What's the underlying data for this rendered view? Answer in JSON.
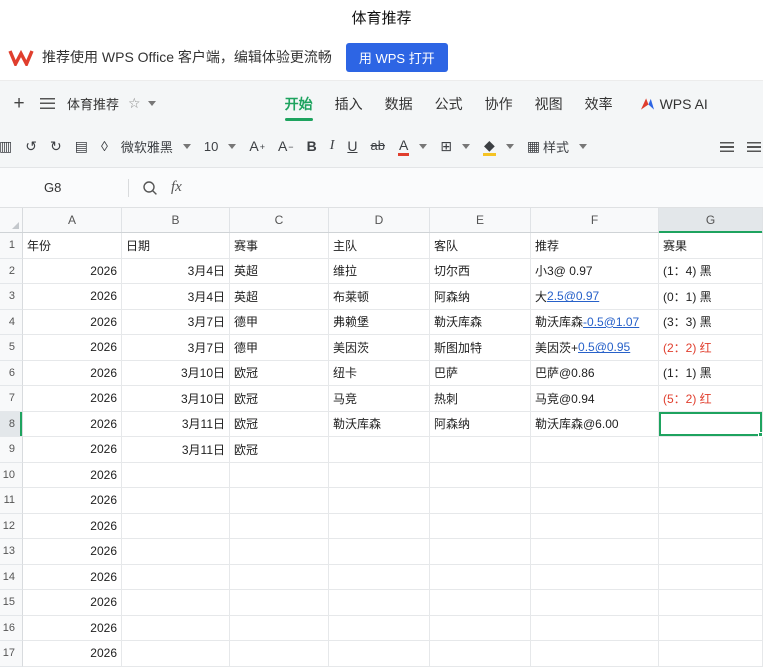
{
  "accent": {
    "green": "#1ea35f",
    "blue_button": "#2d65e4",
    "link": "#2761c9",
    "red": "#e03e2d"
  },
  "titlebar": {
    "title": "体育推荐"
  },
  "banner": {
    "logo": "wps-logo",
    "text": "推荐使用 WPS Office 客户端，编辑体验更流畅",
    "button_label": "用 WPS 打开"
  },
  "menubar": {
    "plus": "+",
    "doc_name": "体育推荐",
    "star": "☆",
    "tabs": [
      "开始",
      "插入",
      "数据",
      "公式",
      "协作",
      "视图",
      "效率"
    ],
    "active_tab": "开始",
    "ai_label": "WPS AI"
  },
  "toolbar": {
    "items": [
      {
        "name": "clipboard-icon",
        "glyph": "▥",
        "cut": true
      },
      {
        "name": "undo-icon",
        "glyph": "↺"
      },
      {
        "name": "redo-icon",
        "glyph": "↻"
      },
      {
        "name": "format-painter-icon",
        "glyph": "▤"
      },
      {
        "name": "eraser-icon",
        "glyph": "◊"
      },
      {
        "name": "font-name-select",
        "label": "微软雅黑",
        "caret": true
      },
      {
        "name": "font-size-select",
        "label": "10",
        "caret": true
      },
      {
        "name": "font-increase-button",
        "glyph": "A",
        "sup": "+"
      },
      {
        "name": "font-decrease-button",
        "glyph": "A",
        "sup": "−"
      },
      {
        "name": "bold-button",
        "glyph": "B",
        "cls": "b"
      },
      {
        "name": "italic-button",
        "glyph": "I",
        "cls": "i"
      },
      {
        "name": "underline-button",
        "glyph": "U",
        "cls": "u"
      },
      {
        "name": "strikethrough-button",
        "glyph": "ab",
        "cls": "s"
      },
      {
        "name": "font-color-button",
        "glyph": "A",
        "bar": "#e03e2d",
        "caret": true
      },
      {
        "name": "borders-button",
        "glyph": "⊞",
        "caret": true
      },
      {
        "name": "fill-color-button",
        "glyph": "◆",
        "bar": "#f5c324",
        "caret": true
      },
      {
        "name": "cell-style-button",
        "glyph": "▦",
        "label": "样式",
        "caret": true
      },
      {
        "name": "align-button",
        "lines": true,
        "push": true
      },
      {
        "name": "align-more-button",
        "lines": true,
        "clipr": true
      }
    ]
  },
  "formula_bar": {
    "cell_ref": "G8",
    "fx_label": "fx"
  },
  "sheet": {
    "columns": [
      "A",
      "B",
      "C",
      "D",
      "E",
      "F",
      "G"
    ],
    "more_label": "⋯",
    "selected_cell": "G8",
    "selected_col": "G",
    "selected_row": 8,
    "rows": [
      {
        "n": 1,
        "cells": [
          {
            "t": "年份"
          },
          {
            "t": "日期"
          },
          {
            "t": "赛事"
          },
          {
            "t": "主队"
          },
          {
            "t": "客队"
          },
          {
            "t": "推荐"
          },
          {
            "t": "赛果"
          }
        ]
      },
      {
        "n": 2,
        "cells": [
          {
            "t": "2026",
            "align": "r"
          },
          {
            "t": "3月4日",
            "align": "r"
          },
          {
            "t": "英超"
          },
          {
            "t": "维拉"
          },
          {
            "t": "切尔西"
          },
          {
            "t": "小3@ 0.97"
          },
          {
            "t": "(1：4) 黑"
          }
        ]
      },
      {
        "n": 3,
        "cells": [
          {
            "t": "2026",
            "align": "r"
          },
          {
            "t": "3月4日",
            "align": "r"
          },
          {
            "t": "英超"
          },
          {
            "t": "布莱顿"
          },
          {
            "t": "阿森纳"
          },
          {
            "parts": [
              {
                "t": "大"
              },
              {
                "t": "2.5@0.97",
                "link": true
              }
            ]
          },
          {
            "t": "(0：1) 黑"
          }
        ]
      },
      {
        "n": 4,
        "cells": [
          {
            "t": "2026",
            "align": "r"
          },
          {
            "t": "3月7日",
            "align": "r"
          },
          {
            "t": "德甲"
          },
          {
            "t": "弗赖堡"
          },
          {
            "t": "勒沃库森"
          },
          {
            "parts": [
              {
                "t": "勒沃库森"
              },
              {
                "t": "-0.5@1.07",
                "link": true
              }
            ]
          },
          {
            "t": "(3：3) 黑"
          }
        ]
      },
      {
        "n": 5,
        "cells": [
          {
            "t": "2026",
            "align": "r"
          },
          {
            "t": "3月7日",
            "align": "r"
          },
          {
            "t": "德甲"
          },
          {
            "t": "美因茨"
          },
          {
            "t": "斯图加特"
          },
          {
            "parts": [
              {
                "t": "美因茨+"
              },
              {
                "t": "0.5@0.95",
                "link": true
              }
            ]
          },
          {
            "t": "(2：2) 红",
            "red": true
          }
        ]
      },
      {
        "n": 6,
        "cells": [
          {
            "t": "2026",
            "align": "r"
          },
          {
            "t": "3月10日",
            "align": "r"
          },
          {
            "t": "欧冠"
          },
          {
            "t": "纽卡"
          },
          {
            "t": "巴萨"
          },
          {
            "t": "巴萨@0.86"
          },
          {
            "t": "(1：1) 黑"
          }
        ]
      },
      {
        "n": 7,
        "cells": [
          {
            "t": "2026",
            "align": "r"
          },
          {
            "t": "3月10日",
            "align": "r"
          },
          {
            "t": "欧冠"
          },
          {
            "t": "马竞"
          },
          {
            "t": "热刺"
          },
          {
            "t": "马竞@0.94"
          },
          {
            "t": "(5：2) 红",
            "red": true
          }
        ]
      },
      {
        "n": 8,
        "cells": [
          {
            "t": "2026",
            "align": "r"
          },
          {
            "t": "3月11日",
            "align": "r"
          },
          {
            "t": "欧冠"
          },
          {
            "t": "勒沃库森"
          },
          {
            "t": "阿森纳"
          },
          {
            "t": "勒沃库森@6.00"
          },
          {
            "t": "",
            "selected": true
          }
        ]
      },
      {
        "n": 9,
        "cells": [
          {
            "t": "2026",
            "align": "r"
          },
          {
            "t": "3月11日",
            "align": "r"
          },
          {
            "t": "欧冠"
          },
          {
            "t": ""
          },
          {
            "t": ""
          },
          {
            "t": ""
          },
          {
            "t": ""
          }
        ]
      },
      {
        "n": 10,
        "cells": [
          {
            "t": "2026",
            "align": "r"
          },
          {
            "t": ""
          },
          {
            "t": ""
          },
          {
            "t": ""
          },
          {
            "t": ""
          },
          {
            "t": ""
          },
          {
            "t": ""
          }
        ]
      },
      {
        "n": 11,
        "cells": [
          {
            "t": "2026",
            "align": "r"
          },
          {
            "t": ""
          },
          {
            "t": ""
          },
          {
            "t": ""
          },
          {
            "t": ""
          },
          {
            "t": ""
          },
          {
            "t": ""
          }
        ]
      },
      {
        "n": 12,
        "cells": [
          {
            "t": "2026",
            "align": "r"
          },
          {
            "t": ""
          },
          {
            "t": ""
          },
          {
            "t": ""
          },
          {
            "t": ""
          },
          {
            "t": ""
          },
          {
            "t": ""
          }
        ]
      },
      {
        "n": 13,
        "cells": [
          {
            "t": "2026",
            "align": "r"
          },
          {
            "t": ""
          },
          {
            "t": ""
          },
          {
            "t": ""
          },
          {
            "t": ""
          },
          {
            "t": ""
          },
          {
            "t": ""
          }
        ]
      },
      {
        "n": 14,
        "cells": [
          {
            "t": "2026",
            "align": "r"
          },
          {
            "t": ""
          },
          {
            "t": ""
          },
          {
            "t": ""
          },
          {
            "t": ""
          },
          {
            "t": ""
          },
          {
            "t": ""
          }
        ]
      },
      {
        "n": 15,
        "cells": [
          {
            "t": "2026",
            "align": "r"
          },
          {
            "t": ""
          },
          {
            "t": ""
          },
          {
            "t": ""
          },
          {
            "t": ""
          },
          {
            "t": ""
          },
          {
            "t": ""
          }
        ]
      },
      {
        "n": 16,
        "cells": [
          {
            "t": "2026",
            "align": "r"
          },
          {
            "t": ""
          },
          {
            "t": ""
          },
          {
            "t": ""
          },
          {
            "t": ""
          },
          {
            "t": ""
          },
          {
            "t": ""
          }
        ]
      },
      {
        "n": 17,
        "cells": [
          {
            "t": "2026",
            "align": "r"
          },
          {
            "t": ""
          },
          {
            "t": ""
          },
          {
            "t": ""
          },
          {
            "t": ""
          },
          {
            "t": ""
          },
          {
            "t": ""
          }
        ]
      }
    ]
  }
}
